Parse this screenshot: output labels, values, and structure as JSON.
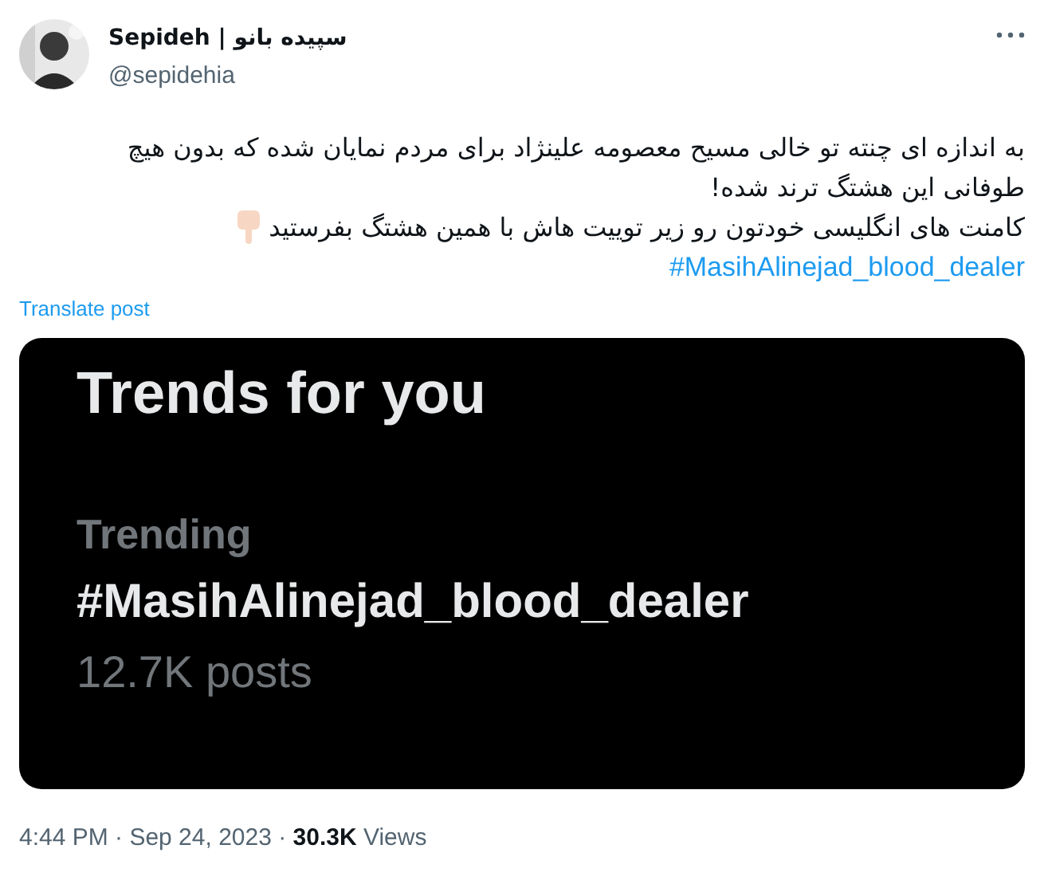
{
  "author": {
    "name": "Sepideh | سپیده بانو",
    "handle": "@sepidehia"
  },
  "body": {
    "lines": [
      "به اندازه ای چنته تو خالی مسیح معصومه علینژاد برای مردم نمایان شده که بدون هیچ طوفانی این هشتگ ترند شده!",
      "کامنت های انگلیسی خودتون رو زیر توییت هاش با همین هشتگ بفرستید"
    ],
    "hashtag": "#MasihAlinejad_blood_dealer"
  },
  "translate_link": "Translate post",
  "embedded_card": {
    "title": "Trends for you",
    "label": "Trending",
    "hashtag": "#MasihAlinejad_blood_dealer",
    "count": "12.7K posts"
  },
  "meta": "4:44 PM · Sep 24, 2023 · **30.3K** Views"
}
